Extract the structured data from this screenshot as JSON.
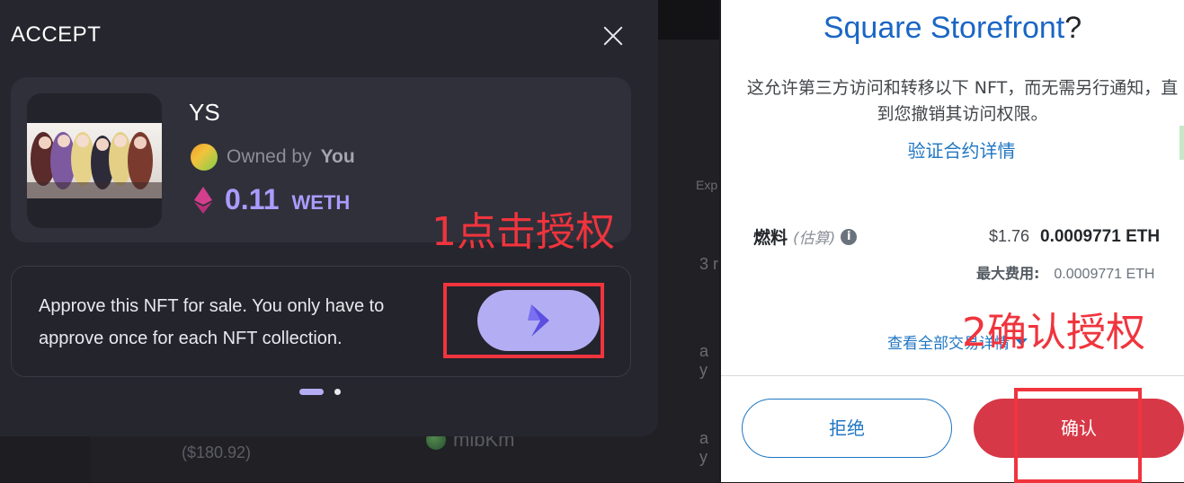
{
  "background": {
    "exp_label": "Exp",
    "row1": "3 r",
    "row2": "a y",
    "row3": "a y",
    "price": "($180.92)",
    "username": "mibKm"
  },
  "modal": {
    "title": "ACCEPT",
    "close_icon": "close-icon",
    "nft": {
      "name": "YS",
      "owned_by": "Owned by",
      "owner": "You",
      "price": "0.11",
      "unit": "WETH"
    },
    "approve": {
      "text": "Approve this NFT for sale. You only have to approve once for each NFT collection.",
      "button_icon": "approve-arrow-icon"
    }
  },
  "annotations": {
    "step1": "1点击授权",
    "step2": "2确认授权",
    "color": "#f0343d"
  },
  "wallet": {
    "site_name": "Square Storefront",
    "title_suffix": "?",
    "description": "这允许第三方访问和转移以下 NFT，而无需另行通知，直到您撤销其访问权限。",
    "verify_link": "验证合约详情",
    "fee": {
      "label": "燃料",
      "estimate": "(估算)",
      "usd": "$1.76",
      "eth": "0.0009771 ETH",
      "max_label": "最大费用:",
      "max_value": "0.0009771 ETH"
    },
    "view_all": "查看全部交易详情",
    "reject": "拒绝",
    "confirm": "确认"
  },
  "colors": {
    "approve_button": "#b3aef3",
    "price_accent": "#a99cff",
    "wallet_link": "#1f76c2",
    "confirm_button": "#d73847"
  }
}
